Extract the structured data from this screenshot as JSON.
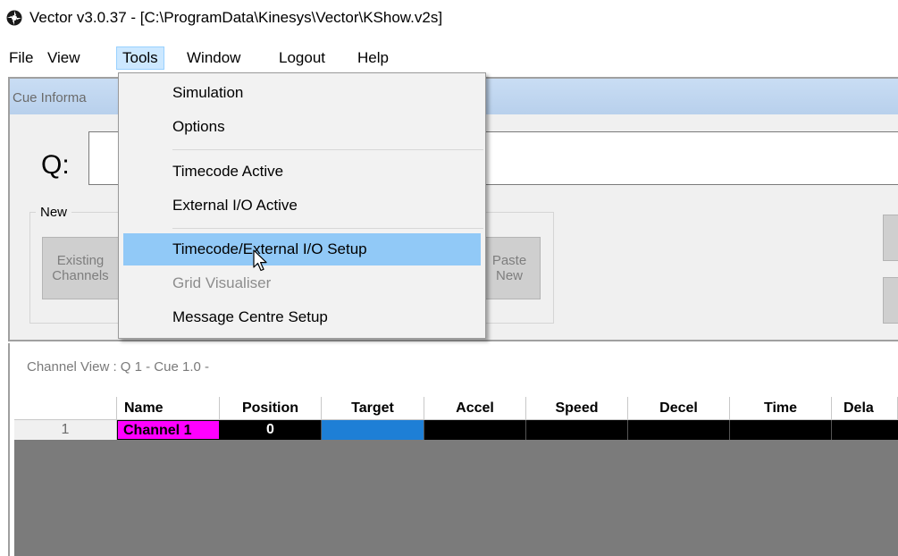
{
  "window": {
    "title": "Vector v3.0.37 - [C:\\ProgramData\\Kinesys\\Vector\\KShow.v2s]"
  },
  "menubar": {
    "items": [
      {
        "label": "File"
      },
      {
        "label": "View"
      },
      {
        "label": "Tools"
      },
      {
        "label": "Window"
      },
      {
        "label": "Logout"
      },
      {
        "label": "Help"
      }
    ],
    "active": "Tools"
  },
  "tools_menu": {
    "items": [
      {
        "label": "Simulation",
        "enabled": true
      },
      {
        "label": "Options",
        "enabled": true
      },
      {
        "label": "Timecode Active",
        "enabled": true
      },
      {
        "label": "External I/O Active",
        "enabled": true
      },
      {
        "label": "Timecode/External I/O Setup",
        "enabled": true,
        "highlighted": true
      },
      {
        "label": "Grid Visualiser",
        "enabled": false
      },
      {
        "label": "Message Centre Setup",
        "enabled": true
      }
    ]
  },
  "cue_panel": {
    "header": "Cue Informa",
    "q_label": "Q:",
    "q_value": "",
    "new_group_label": "New",
    "existing_channels_label": "Existing\nChannels",
    "paste_new_label": "Paste\nNew"
  },
  "channel_view": {
    "label": "Channel View : Q 1 - Cue 1.0 -",
    "columns": [
      "",
      "Name",
      "Position",
      "Target",
      "Accel",
      "Speed",
      "Decel",
      "Time",
      "Dela"
    ],
    "rows": [
      {
        "index": "1",
        "name": "Channel 1",
        "position": "0",
        "target": "",
        "accel": "",
        "speed": "",
        "decel": "",
        "time": "",
        "delay": ""
      }
    ]
  },
  "colors": {
    "menu_highlight": "#91c9f7",
    "channel_name_bg": "#ff00ff",
    "target_cell_bg": "#1e7fd6",
    "grid_background": "#7b7b7b",
    "cue_header": "#b8d0ec"
  }
}
